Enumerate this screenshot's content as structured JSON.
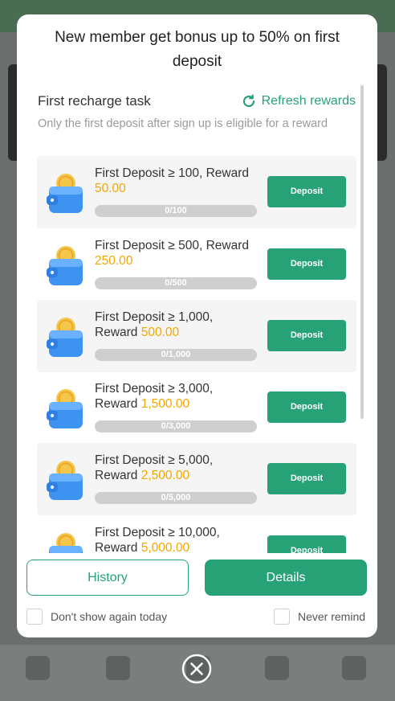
{
  "modal": {
    "title": "New member get bonus up to 50% on first deposit",
    "task_title": "First recharge task",
    "refresh_label": "Refresh rewards",
    "subtitle": "Only the first deposit after sign up is eligible for a reward",
    "deposit_label": "Deposit",
    "tasks": [
      {
        "text": "First Deposit ≥ 100, Reward",
        "reward": "50.00",
        "progress": "0/100"
      },
      {
        "text": "First Deposit ≥ 500, Reward",
        "reward": "250.00",
        "progress": "0/500"
      },
      {
        "text": "First Deposit ≥ 1,000, Reward",
        "reward": "500.00",
        "progress": "0/1,000"
      },
      {
        "text": "First Deposit ≥ 3,000, Reward",
        "reward": "1,500.00",
        "progress": "0/3,000"
      },
      {
        "text": "First Deposit ≥ 5,000, Reward",
        "reward": "2,500.00",
        "progress": "0/5,000"
      },
      {
        "text": "First Deposit ≥ 10,000, Reward",
        "reward": "5,000.00",
        "progress": ""
      }
    ],
    "history_label": "History",
    "details_label": "Details",
    "dont_show_today": "Don't show again today",
    "never_remind": "Never remind"
  },
  "colors": {
    "accent": "#27a277",
    "reward": "#f0a800"
  },
  "icons": {
    "refresh": "refresh-icon",
    "wallet": "wallet-coin-icon",
    "close": "close-circle-icon"
  }
}
